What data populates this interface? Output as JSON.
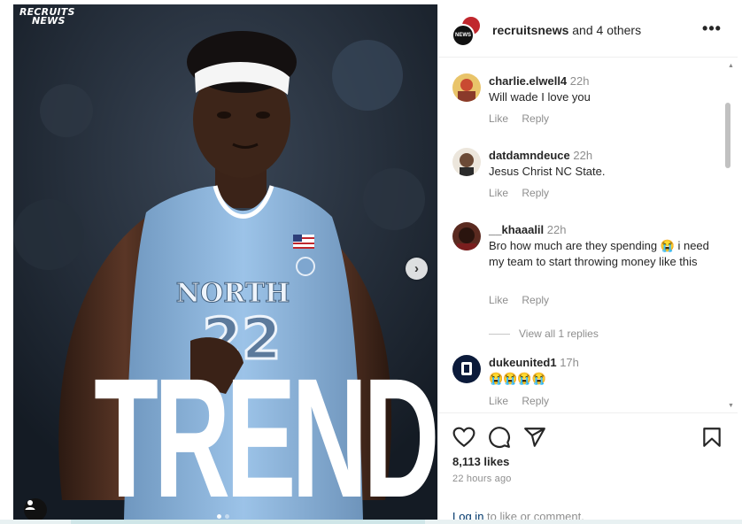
{
  "media": {
    "brand_line1": "RECRUITS",
    "brand_line2": "NEWS",
    "overlay_text": "TRENDING",
    "jersey_team": "NORTH",
    "jersey_number": "22",
    "next_icon": "chevron-right-icon",
    "tag_icon": "user-tag-icon",
    "carousel_dots": 2,
    "carousel_active": 0
  },
  "header": {
    "username": "recruitsnews",
    "others_text": " and 4 others",
    "avatar_text": "NEWS",
    "more_icon": "more-horizontal-icon"
  },
  "comments": [
    {
      "username": "charlie.elwell4",
      "time": "22h",
      "text": "Will wade I love you",
      "like_label": "Like",
      "reply_label": "Reply",
      "avatar_color": "#c94a32"
    },
    {
      "username": "datdamndeuce",
      "time": "22h",
      "text": "Jesus Christ NC State.",
      "like_label": "Like",
      "reply_label": "Reply",
      "avatar_color": "#d9cfc2"
    },
    {
      "username": "__khaaalil",
      "time": "22h",
      "text": "Bro how much are they spending 😭 i need my team to start throwing money like this",
      "like_label": "Like",
      "reply_label": "Reply",
      "avatar_color": "#3a1f18"
    },
    {
      "username": "dukeunited1",
      "time": "17h",
      "text": "😭😭😭😭",
      "like_label": "Like",
      "reply_label": "Reply",
      "avatar_color": "#0b1a3a"
    }
  ],
  "view_replies": "View all 1 replies",
  "actions": {
    "like_icon": "heart-icon",
    "comment_icon": "comment-icon",
    "share_icon": "send-icon",
    "save_icon": "bookmark-icon"
  },
  "likes_text": "8,113 likes",
  "time_ago": "22 hours ago",
  "login": {
    "link": "Log in",
    "rest": " to like or comment."
  },
  "colors": {
    "jersey": "#8db6de",
    "link": "#00376b",
    "muted": "#8e8e8e"
  }
}
